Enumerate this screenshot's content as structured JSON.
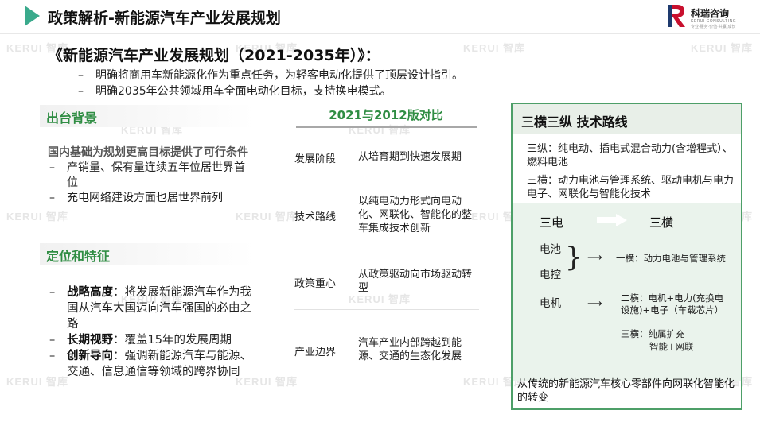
{
  "header": {
    "title": "政策解析-新能源汽车产业发展规划",
    "logo_name": "科瑞咨询",
    "logo_sub": "KERUI CONSULTING",
    "logo_sub2": "专业·服务·价值·共赢·成长"
  },
  "watermark": "KERUI 智库",
  "plan": {
    "title": "《新能源汽车产业发展规划（2021-2035年）》：",
    "bullets": [
      "明确将商用车新能源化作为重点任务，为轻客电动化提供了顶层设计指引。",
      "明确2035年公共领域用车全面电动化目标，支持换电模式。"
    ]
  },
  "background": {
    "heading": "出台背景",
    "title": "国内基础为规划更高目标提供了可行条件",
    "items": [
      "产销量、保有量连续五年位居世界首位",
      "充电网络建设方面也居世界前列"
    ]
  },
  "positioning": {
    "heading": "定位和特征",
    "items": [
      {
        "term": "战略高度",
        "sep": "：",
        "text": "将发展新能源汽车作为我国从汽车大国迈向汽车强国的必由之路"
      },
      {
        "term": "长期视野",
        "sep": "：",
        "text": "覆盖15年的发展周期"
      },
      {
        "term": "创新导向",
        "sep": "：",
        "text": "强调新能源汽车与能源、交通、信息通信等领域的跨界协同"
      }
    ]
  },
  "comparison": {
    "title": "2021与2012版对比",
    "rows": [
      {
        "label": "发展阶段",
        "value": "从培育期到快速发展期"
      },
      {
        "label": "技术路线",
        "value": "以纯电动力形式向电动化、网联化、智能化的整车集成技术创新"
      },
      {
        "label": "政策重心",
        "value": "从政策驱动向市场驱动转型"
      },
      {
        "label": "产业边界",
        "value": "汽车产业内部跨越到能源、交通的生态化发展"
      }
    ]
  },
  "tech": {
    "title": "三横三纵 技术路线",
    "vertical": "三纵：纯电动、插电式混合动力(含增程式）、燃料电池",
    "horizontal": "三横：动力电池与管理系统、驱动电机与电力电子、网联化与智能化技术",
    "three_e": "三电",
    "three_h": "三横",
    "battery": "电池",
    "control": "电控",
    "motor": "电机",
    "h1": "一横：动力电池与管理系统",
    "h2_line1": "二横：电机+电力(充换电",
    "h2_line2": "设施)+电子（车载芯片）",
    "h3_line1": "三横：纯属扩充",
    "h3_line2": "智能+网联",
    "footer": "从传统的新能源汽车核心零部件向网联化智能化的转变"
  }
}
